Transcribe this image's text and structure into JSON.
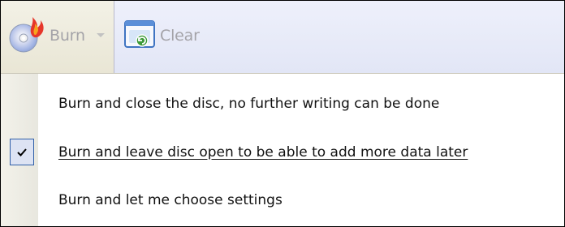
{
  "toolbar": {
    "burn_label": "Burn",
    "clear_label": "Clear",
    "icons": {
      "burn": "burn-disc-flame-icon",
      "dropdown": "chevron-down-icon",
      "clear": "clear-list-icon"
    },
    "state": "disabled"
  },
  "menu": {
    "items": [
      {
        "label": "Burn and close the disc, no further writing can be done",
        "checked": false
      },
      {
        "label": "Burn and leave disc open to be able to add more data later",
        "checked": true
      },
      {
        "label": "Burn and let me choose settings",
        "checked": false
      }
    ],
    "check_icon": "checkmark-icon"
  },
  "colors": {
    "toolbar_left_bg": "#efedde",
    "toolbar_right_bg": "#e4e8f7",
    "disabled_text": "#a4a3a8",
    "check_highlight_bg": "#dde3f3",
    "check_highlight_border": "#2f5ea8",
    "menu_gutter": "#eeede5"
  }
}
